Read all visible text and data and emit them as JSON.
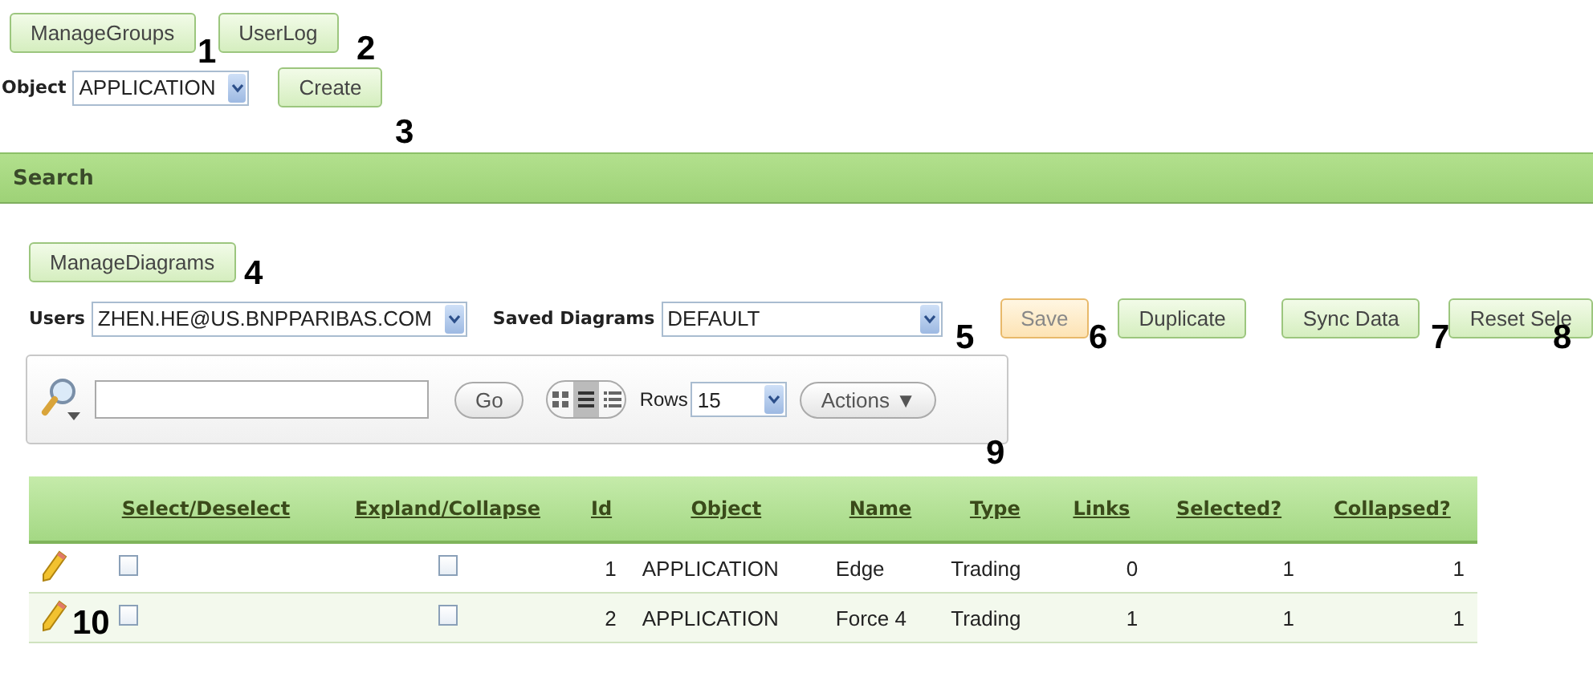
{
  "top_buttons": [
    {
      "label": "ManageGroups"
    },
    {
      "label": "UserLog"
    }
  ],
  "object_field": {
    "label": "Object",
    "value": "APPLICATION"
  },
  "create_button": {
    "label": "Create"
  },
  "search_region": {
    "title": "Search"
  },
  "manage_diagrams_button": {
    "label": "ManageDiagrams"
  },
  "users_field": {
    "label": "Users",
    "value": "ZHEN.HE@US.BNPPARIBAS.COM"
  },
  "saved_diagrams_field": {
    "label": "Saved Diagrams",
    "value": "DEFAULT"
  },
  "diagram_buttons": [
    {
      "label": "Save",
      "kind": "warning"
    },
    {
      "label": "Duplicate",
      "kind": "normal"
    },
    {
      "label": "Sync Data",
      "kind": "normal"
    },
    {
      "label": "Reset Sele",
      "kind": "normal"
    }
  ],
  "toolbar": {
    "view_modes": [
      {
        "kind": "icons",
        "selected": false
      },
      {
        "kind": "report",
        "selected": true
      },
      {
        "kind": "details",
        "selected": false
      }
    ],
    "go_label": "Go",
    "rows_label": "Rows",
    "rows_value": "15",
    "actions_label": "Actions ▼"
  },
  "table": {
    "columns": [
      "Select/Deselect",
      "Expland/Collapse",
      "Id",
      "Object",
      "Name",
      "Type",
      "Links",
      "Selected?",
      "Collapsed?"
    ],
    "rows": [
      {
        "select_checked": false,
        "expand_checked": false,
        "id": "1",
        "object": "APPLICATION",
        "name": "Edge",
        "type": "Trading",
        "links": "0",
        "selected_value": "1",
        "collapsed_value": "1"
      },
      {
        "select_checked": false,
        "expand_checked": false,
        "id": "2",
        "object": "APPLICATION",
        "name": "Force 4",
        "type": "Trading",
        "links": "1",
        "selected_value": "1",
        "collapsed_value": "1"
      }
    ]
  },
  "callouts": [
    "1",
    "2",
    "3",
    "4",
    "5",
    "6",
    "7",
    "8",
    "9",
    "10"
  ]
}
